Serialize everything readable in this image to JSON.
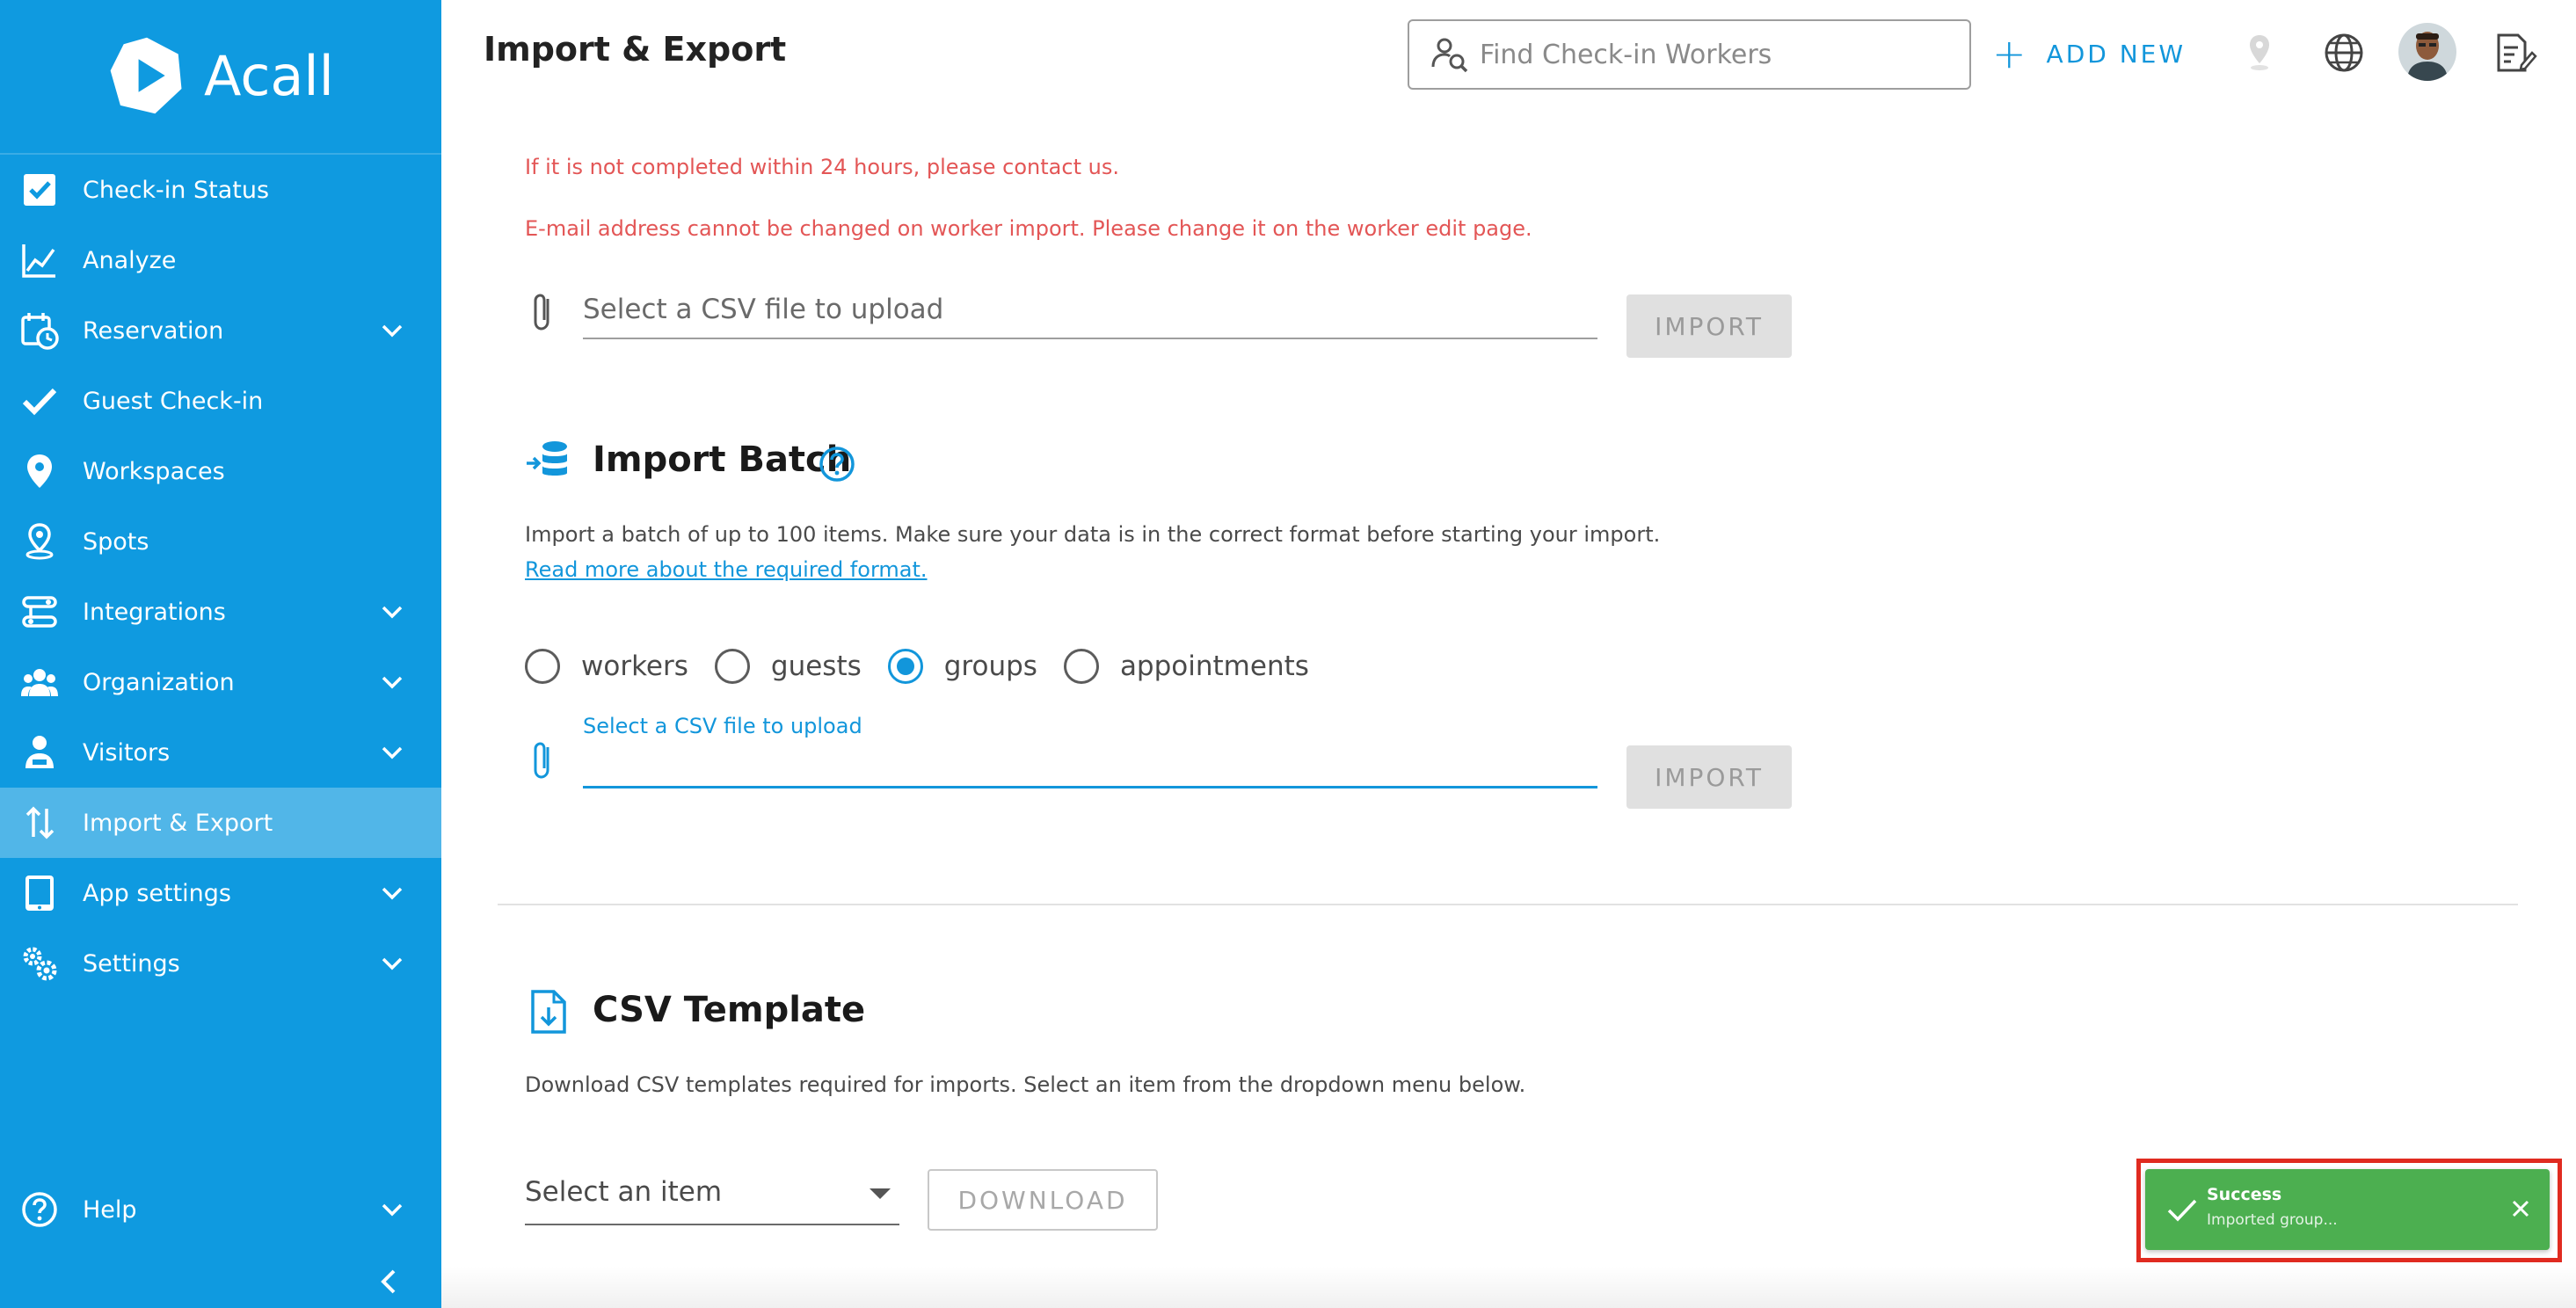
{
  "app": {
    "name": "Acall"
  },
  "sidebar": {
    "items": [
      {
        "label": "Check-in Status",
        "icon": "checkbox-icon",
        "expandable": false
      },
      {
        "label": "Analyze",
        "icon": "line-chart-icon",
        "expandable": false
      },
      {
        "label": "Reservation",
        "icon": "calendar-clock-icon",
        "expandable": true
      },
      {
        "label": "Guest Check-in",
        "icon": "check-icon",
        "expandable": false
      },
      {
        "label": "Workspaces",
        "icon": "location-pin-icon",
        "expandable": false
      },
      {
        "label": "Spots",
        "icon": "spot-pin-icon",
        "expandable": false
      },
      {
        "label": "Integrations",
        "icon": "integrations-icon",
        "expandable": true
      },
      {
        "label": "Organization",
        "icon": "people-icon",
        "expandable": true
      },
      {
        "label": "Visitors",
        "icon": "visitor-icon",
        "expandable": true
      },
      {
        "label": "Import & Export",
        "icon": "import-export-icon",
        "expandable": false,
        "active": true
      },
      {
        "label": "App settings",
        "icon": "tablet-icon",
        "expandable": true
      },
      {
        "label": "Settings",
        "icon": "gears-icon",
        "expandable": true
      }
    ],
    "help_label": "Help"
  },
  "header": {
    "title": "Import & Export",
    "search_placeholder": "Find Check-in Workers",
    "add_new_label": "ADD NEW"
  },
  "import_workers": {
    "warning_1": "If it is not completed within 24 hours, please contact us.",
    "warning_2": "E-mail address cannot be changed on worker import. Please change it on the worker edit page.",
    "file_placeholder": "Select a CSV file to upload",
    "import_label": "IMPORT"
  },
  "import_batch": {
    "title": "Import Batch",
    "description": "Import a batch of up to 100 items. Make sure your data is in the correct format before starting your import.",
    "link": "Read more about the required format.",
    "options": [
      {
        "label": "workers",
        "selected": false
      },
      {
        "label": "guests",
        "selected": false
      },
      {
        "label": "groups",
        "selected": true
      },
      {
        "label": "appointments",
        "selected": false
      }
    ],
    "file_label": "Select a CSV file to upload",
    "import_label": "IMPORT"
  },
  "csv_template": {
    "title": "CSV Template",
    "description": "Download CSV templates required for imports. Select an item from the dropdown menu below.",
    "select_placeholder": "Select an item",
    "download_label": "DOWNLOAD"
  },
  "toast": {
    "title": "Success",
    "message": "Imported group..."
  },
  "colors": {
    "sidebar": "#0f9ae0",
    "accent": "#1296db",
    "warning": "#e35656",
    "success": "#4caf50",
    "highlight": "#e02b20"
  }
}
